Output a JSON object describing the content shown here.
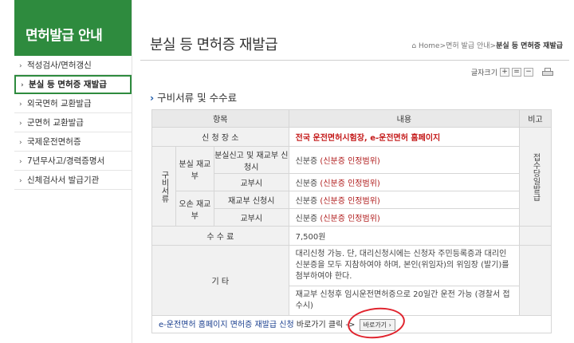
{
  "sidebar": {
    "title": "면허발급 안내",
    "items": [
      {
        "label": "적성검사/면허갱신",
        "active": false
      },
      {
        "label": "분실 등 면허증 재발급",
        "active": true
      },
      {
        "label": "외국면허 교환발급",
        "active": false
      },
      {
        "label": "군면허 교환발급",
        "active": false
      },
      {
        "label": "국제운전면허증",
        "active": false
      },
      {
        "label": "7년무사고/경력증명서",
        "active": false
      },
      {
        "label": "신체검사서 발급기관",
        "active": false
      }
    ]
  },
  "header": {
    "title": "분실 등 면허증 재발급",
    "breadcrumb": {
      "home": "Home",
      "sep": ">",
      "parent": "면허 발급 안내",
      "current": "분실 등 면허증 재발급"
    },
    "font_size_label": "글자크기",
    "font_buttons": {
      "plus": "+",
      "reset": "=",
      "minus": "−"
    }
  },
  "section": {
    "title": "구비서류 및 수수료"
  },
  "table": {
    "headers": {
      "item": "항목",
      "content": "내용",
      "note": "비고"
    },
    "place_label": "신 청 장 소",
    "place_value": "전국 운전면허시험장, e-운전면허 홈페이지",
    "group_label": "구비서류",
    "lost_label": "분실 재교부",
    "lost_reissue_label": "분실신고 및 재교부 신청시",
    "delivery_label": "교부시",
    "damaged_label": "오손 재교부",
    "damaged_reissue_label": "재교부 신청시",
    "id_prefix": "신분증 ",
    "id_detail": "(신분증 인정범위)",
    "note_vertical": "접수당일발급",
    "fee_label": "수 수 료",
    "fee_value": "7,500원",
    "etc_label": "기 타",
    "etc_text1": "대리신청 가능. 단, 대리신청시에는 신청자 주민등록증과 대리인 신분증을 모두 지참하여야 하며, 본인(위임자)의 위임장 (발기)를 첨부하여야 한다.",
    "etc_text2": "재교부 신청후 임시운전면허증으로 20일간 운전 가능 (경찰서 접수시)",
    "link_text": "e-운전면허 홈페이지 면허증 재발급 신청",
    "link_suffix": " 바로가기 클릭 -> ",
    "go_button": "바로가기 ›"
  }
}
